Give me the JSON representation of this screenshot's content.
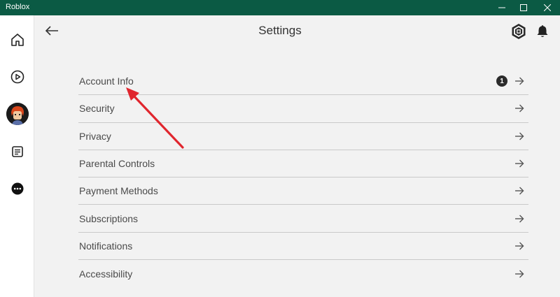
{
  "window": {
    "title": "Roblox",
    "controls": [
      "minimize-icon",
      "maximize-icon",
      "close-icon"
    ]
  },
  "sidebar": {
    "items": [
      {
        "name": "home",
        "icon": "home-icon"
      },
      {
        "name": "play",
        "icon": "play-circle-icon"
      },
      {
        "name": "avatar",
        "icon": "avatar-icon"
      },
      {
        "name": "chat",
        "icon": "notes-icon"
      },
      {
        "name": "more",
        "icon": "more-dots-icon"
      }
    ]
  },
  "header": {
    "title": "Settings",
    "back_icon": "arrow-left-icon",
    "robux_icon": "robux-icon",
    "bell_icon": "bell-icon"
  },
  "settings": {
    "items": [
      {
        "label": "Account Info",
        "badge": "1"
      },
      {
        "label": "Security"
      },
      {
        "label": "Privacy"
      },
      {
        "label": "Parental Controls"
      },
      {
        "label": "Payment Methods"
      },
      {
        "label": "Subscriptions"
      },
      {
        "label": "Notifications"
      },
      {
        "label": "Accessibility"
      }
    ]
  },
  "colors": {
    "titlebar": "#0b5a44",
    "annotation": "#e0262e",
    "badge": "#2b2b2b"
  }
}
